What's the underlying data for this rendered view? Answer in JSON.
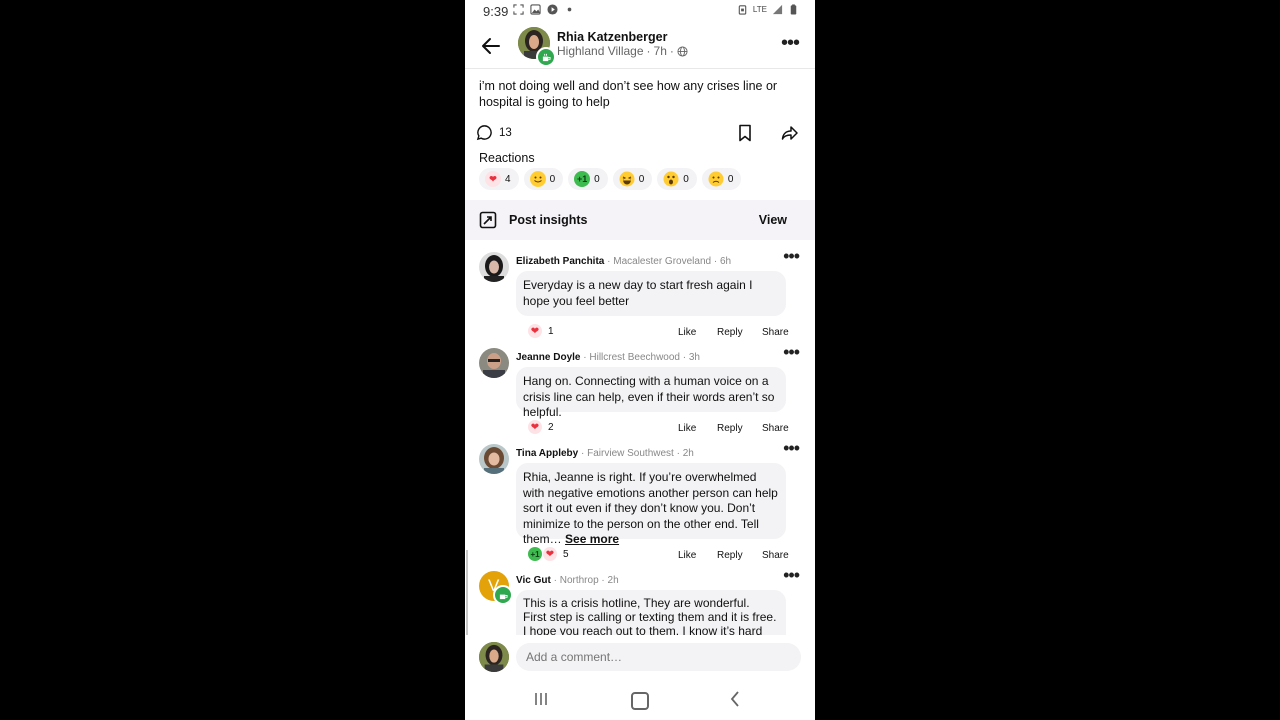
{
  "status_bar": {
    "time": "9:39",
    "signal_label": "LTE"
  },
  "post": {
    "author_name": "Rhia Katzenberger",
    "author_location": "Highland Village",
    "post_time": "7h",
    "body": "i’m not doing well and don’t see how any crises line or hospital is going to help",
    "comment_count": "13",
    "reactions_label": "Reactions",
    "reactions": [
      {
        "emoji": "heart-emoji",
        "count": "4",
        "color": "#fde3e6"
      },
      {
        "emoji": "smile-emoji",
        "count": "0",
        "color": "#fff1c4"
      },
      {
        "emoji": "plus-one-emoji",
        "count": "0",
        "color": "#d7f5cf"
      },
      {
        "emoji": "laugh-emoji",
        "count": "0",
        "color": "#fff1c4"
      },
      {
        "emoji": "surprised-emoji",
        "count": "0",
        "color": "#fff1c4"
      },
      {
        "emoji": "sad-emoji",
        "count": "0",
        "color": "#fff1c4"
      }
    ]
  },
  "insights": {
    "label": "Post insights",
    "view_label": "View"
  },
  "comments": [
    {
      "name": "Elizabeth Panchita",
      "location": "Macalester Groveland",
      "time": "6h",
      "text": "Everyday is a new day to start fresh again I hope you feel better",
      "reaction_count": "1"
    },
    {
      "name": "Jeanne Doyle",
      "location": "Hillcrest Beechwood",
      "time": "3h",
      "text": "Hang on.  Connecting with a human voice on a crisis line can help, even if their words aren’t so helpful.",
      "reaction_count": "2"
    },
    {
      "name": "Tina Appleby",
      "location": "Fairview Southwest",
      "time": "2h",
      "text": "Rhia, Jeanne is right. If you’re overwhelmed with negative emotions another person can help sort it out even if they don’t know you. Don’t minimize to the person on the other end. Tell them…",
      "see_more": "See more",
      "reaction_count": "5"
    },
    {
      "name": "Vic Gut",
      "location": "Northrop",
      "time": "2h",
      "avatar_letter": "V",
      "text_lines": [
        "This is a crisis hotline,  They are wonderful.",
        "First step is calling or texting them and it is free.",
        "I hope you reach out to them. I know it’s hard"
      ]
    }
  ],
  "comment_actions": {
    "like": "Like",
    "reply": "Reply",
    "share": "Share"
  },
  "add_comment": {
    "placeholder": "Add a comment…"
  },
  "colors": {
    "accent_green": "#2fa84f",
    "bubble": "#f3f2f4",
    "insights_bg": "#f6f3f8",
    "heart": "#e8323f"
  }
}
